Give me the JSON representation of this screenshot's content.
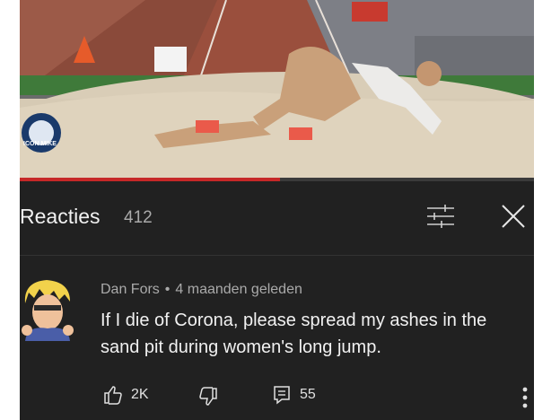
{
  "panel": {
    "title": "Reacties",
    "count": "412"
  },
  "video": {
    "watermark": "ICON MIKE"
  },
  "comment": {
    "author": "Dan Fors",
    "separator": "•",
    "time": "4 maanden geleden",
    "text": "If I die of Corona, please spread my ashes in the sand pit during women's long jump.",
    "likes": "2K",
    "replies": "55"
  },
  "colors": {
    "background": "#212121",
    "text_primary": "#f1f1f1",
    "text_secondary": "#aaaaaa",
    "progress": "#c62828"
  },
  "icons": [
    "filter-icon",
    "close-icon",
    "thumbs-up-icon",
    "thumbs-down-icon",
    "reply-icon",
    "more-vert-icon"
  ]
}
